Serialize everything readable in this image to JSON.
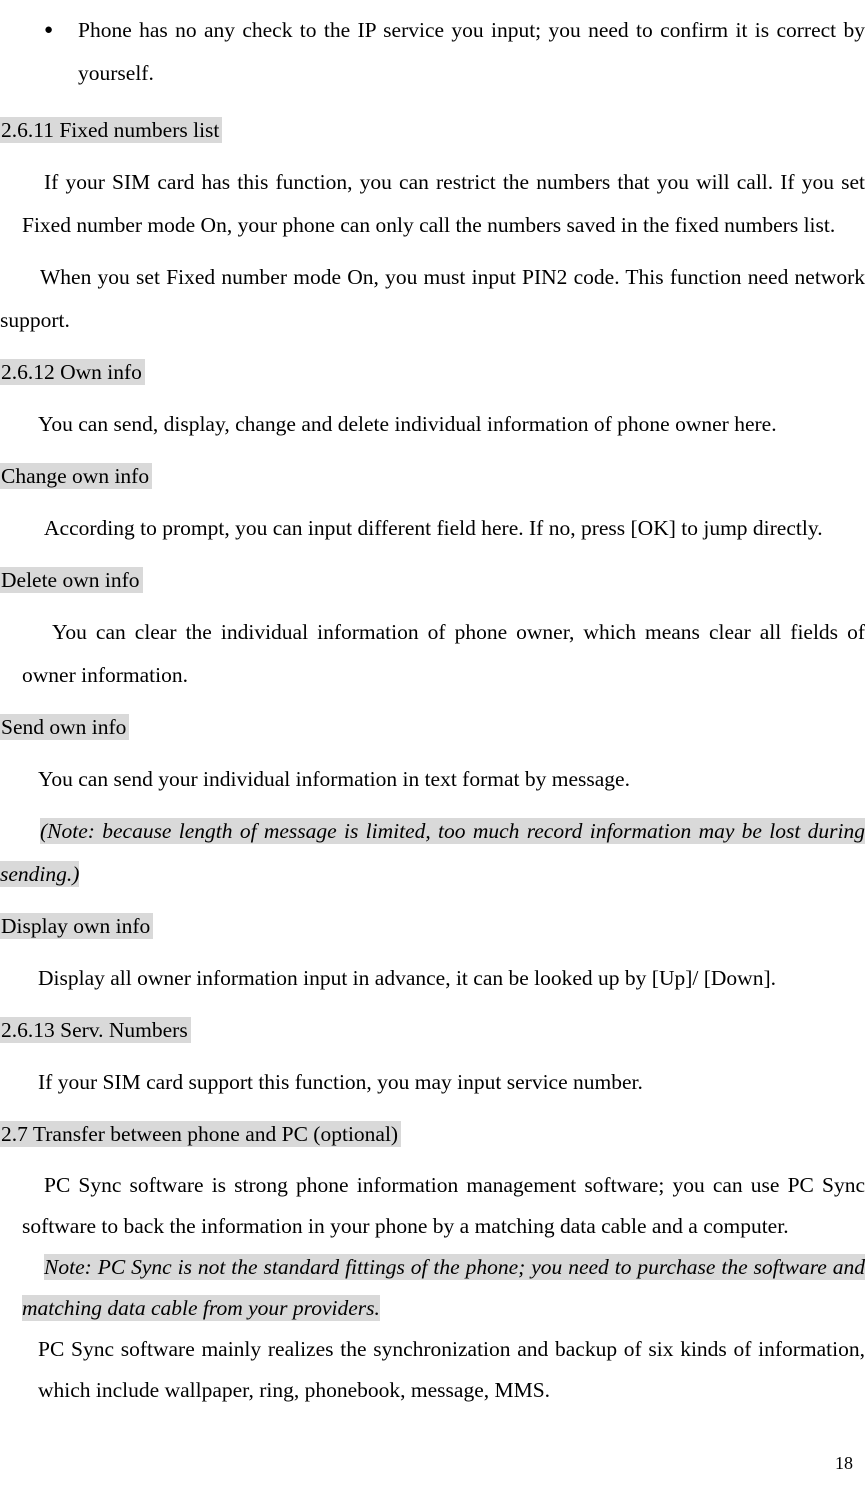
{
  "document": {
    "page_number": "18",
    "highlight_color": "#d9d9d9",
    "text_color": "#000000",
    "background_color": "#ffffff",
    "bullet_icon": "bullet-point-icon"
  },
  "blocks": {
    "bullet_1": "Phone has no any check to the IP service you input; you need to confirm it is correct by yourself.",
    "heading_2_6_11": "2.6.11 Fixed numbers list",
    "para_fixed_1": "If your SIM card has this function, you can restrict the numbers that you will call. If you set Fixed number mode On, your phone can only call the numbers saved in the fixed numbers list.",
    "para_fixed_2": "When you set Fixed number mode On, you must input PIN2 code. This function need network support.",
    "heading_2_6_12": "2.6.12 Own info",
    "para_own_info": "You can send, display, change and delete individual information of phone owner here.",
    "heading_change_own_info": "Change own info",
    "para_change_own_info": "According to prompt, you can input different field here. If no, press [OK] to jump directly.",
    "heading_delete_own_info": "Delete own info",
    "para_delete_own_info": "You can clear the individual information of phone owner, which means clear all fields of owner information.",
    "heading_send_own_info": "Send own info",
    "para_send_own_info": "You can send your individual information in text format by message.",
    "note_send_own_info": "(Note: because length of message is limited, too much record information may be lost during sending.)",
    "heading_display_own_info": "Display own info",
    "para_display_own_info": "Display all owner information input in advance, it can be looked up by [Up]/ [Down].",
    "heading_2_6_13": "2.6.13 Serv. Numbers",
    "para_serv_numbers": "If your SIM card support this function, you may input service number.",
    "heading_2_7": "2.7 Transfer between phone and PC (optional)",
    "para_pc_sync_1": "PC Sync software is strong phone information management software; you can use PC Sync software to back the information in your phone by a matching data cable and a computer.",
    "note_pc_sync": "Note: PC Sync is not the standard fittings of the phone; you need to purchase the software and matching data cable from your providers.",
    "para_pc_sync_2": "PC Sync software mainly realizes the synchronization and backup of six kinds of information, which include wallpaper, ring, phonebook, message, MMS."
  }
}
